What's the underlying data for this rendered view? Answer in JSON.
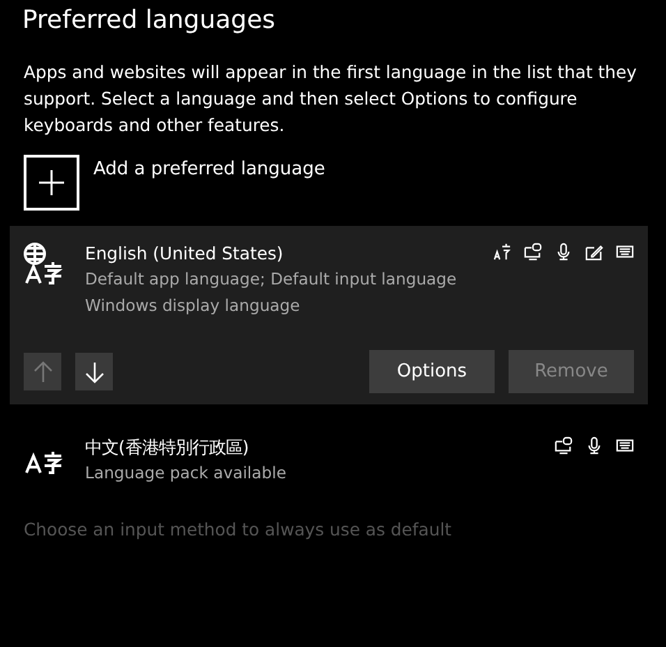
{
  "title": "Preferred languages",
  "description": "Apps and websites will appear in the first language in the list that they support. Select a language and then select Options to configure keyboards and other features.",
  "add_button": {
    "label": "Add a preferred language"
  },
  "languages": [
    {
      "name": "English (United States)",
      "details": [
        "Default app language; Default input language",
        "Windows display language"
      ],
      "kind": "globe",
      "selected": true,
      "features": [
        {
          "kind": "speech"
        },
        {
          "kind": "display"
        },
        {
          "kind": "microphone"
        },
        {
          "kind": "handwriting"
        },
        {
          "kind": "keyboard"
        }
      ],
      "move_up": {
        "disabled": true
      },
      "move_down": {
        "disabled": false
      },
      "buttons": [
        {
          "label": "Options",
          "disabled": false
        },
        {
          "label": "Remove",
          "disabled": true
        }
      ]
    },
    {
      "name": "中文(香港特別行政區)",
      "details": [
        "Language pack available"
      ],
      "kind": "plain",
      "selected": false,
      "features": [
        {
          "kind": "display"
        },
        {
          "kind": "microphone"
        },
        {
          "kind": "keyboard"
        }
      ]
    }
  ],
  "input_method_link": {
    "label": "Choose an input method to always use as default",
    "disabled": true
  }
}
